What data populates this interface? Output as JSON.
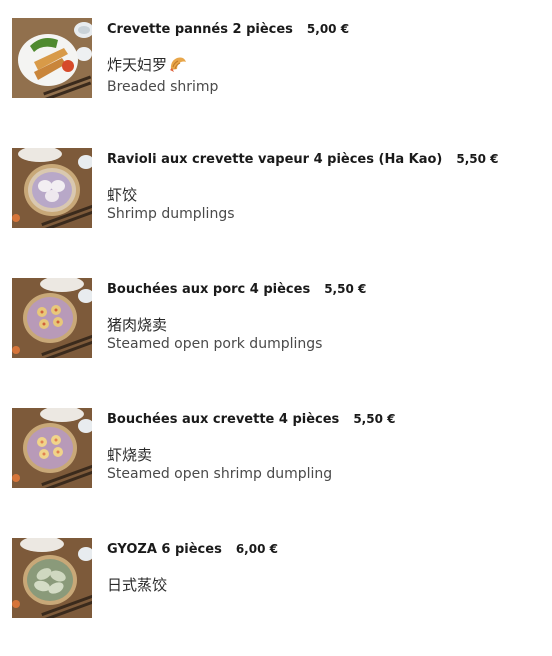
{
  "menu": {
    "items": [
      {
        "name": "Crevette pannés 2 pièces",
        "price": "5,00 €",
        "chinese": "炸天妇罗",
        "emoji": "fried-shrimp-emoji",
        "english": "Breaded shrimp",
        "image": "breaded-shrimp-photo"
      },
      {
        "name": "Ravioli aux crevette vapeur 4 pièces (Ha Kao)",
        "price": "5,50 €",
        "chinese": "虾饺",
        "english": "Shrimp dumplings",
        "image": "shrimp-dumplings-photo"
      },
      {
        "name": "Bouchées aux porc 4 pièces",
        "price": "5,50 €",
        "chinese": "猪肉烧卖",
        "english": "Steamed open pork dumplings",
        "image": "pork-siu-mai-photo"
      },
      {
        "name": "Bouchées aux crevette 4 pièces",
        "price": "5,50 €",
        "chinese": "虾烧卖",
        "english": "Steamed open shrimp dumpling",
        "image": "shrimp-siu-mai-photo"
      },
      {
        "name": "GYOZA 6 pièces",
        "price": "6,00 €",
        "chinese": "日式蒸饺",
        "english": "",
        "image": "gyoza-photo"
      }
    ]
  }
}
